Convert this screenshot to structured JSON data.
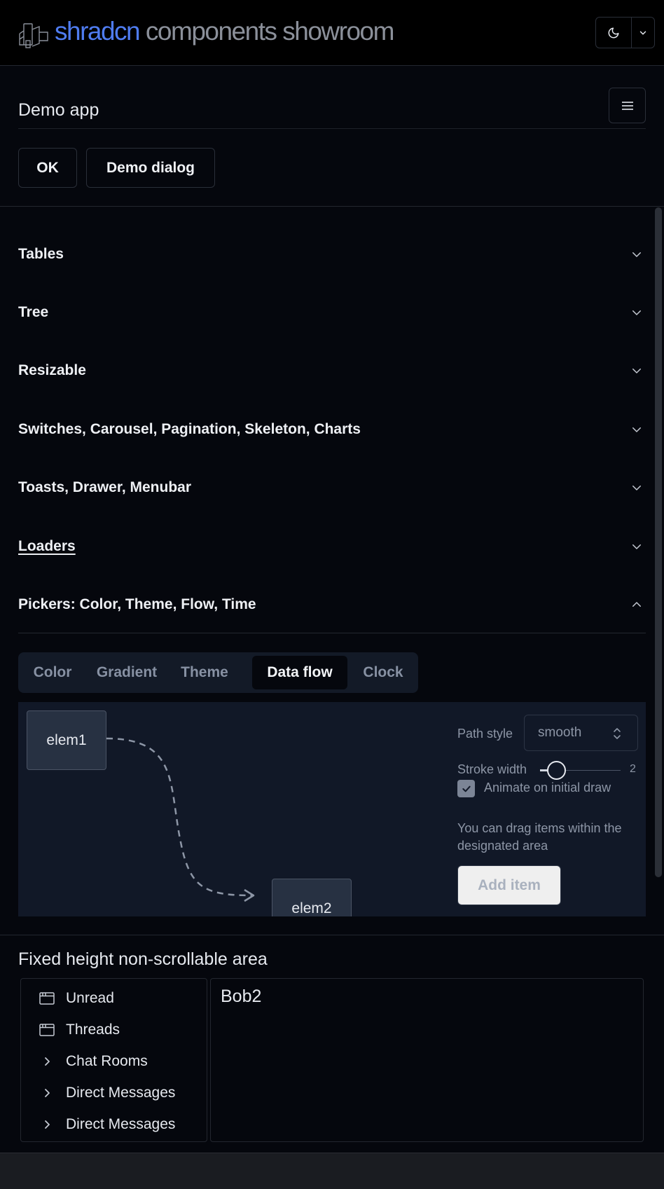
{
  "header": {
    "brand_part1": "shradcn",
    "brand_part2": " components showroom",
    "theme_icon": "moon-icon",
    "theme_menu_icon": "chevron-down-icon"
  },
  "app": {
    "title": "Demo app",
    "menu_icon": "hamburger-icon",
    "ok_label": "OK",
    "dialog_label": "Demo dialog"
  },
  "accordion": {
    "items": [
      {
        "label": "Tables",
        "expanded": false
      },
      {
        "label": "Tree",
        "expanded": false
      },
      {
        "label": "Resizable",
        "expanded": false
      },
      {
        "label": "Switches, Carousel, Pagination, Skeleton, Charts",
        "expanded": false
      },
      {
        "label": "Toasts, Drawer, Menubar",
        "expanded": false
      },
      {
        "label": "Loaders",
        "expanded": false
      },
      {
        "label": "Pickers: Color, Theme, Flow, Time",
        "expanded": true
      }
    ]
  },
  "pickers": {
    "tabs": [
      {
        "label": "Color",
        "active": false
      },
      {
        "label": "Gradient",
        "active": false
      },
      {
        "label": "Theme",
        "active": false
      },
      {
        "label": "Data flow",
        "active": true
      },
      {
        "label": "Clock",
        "active": false
      }
    ],
    "flow": {
      "nodes": [
        "elem1",
        "elem2"
      ],
      "path_style_label": "Path style",
      "path_style_value": "smooth",
      "stroke_width_label": "Stroke width",
      "stroke_width_value": "2",
      "animate_label": "Animate on initial draw",
      "animate_checked": true,
      "hint": "You can drag items within the designated area",
      "add_item_label": "Add item"
    }
  },
  "fixed": {
    "title": "Fixed height non-scrollable area",
    "nav": [
      {
        "label": "Unread",
        "icon": "inbox-icon"
      },
      {
        "label": "Threads",
        "icon": "inbox-icon"
      },
      {
        "label": "Chat Rooms",
        "icon": "chevron-right-icon"
      },
      {
        "label": "Direct Messages",
        "icon": "chevron-right-icon"
      },
      {
        "label": "Direct Messages",
        "icon": "chevron-right-icon"
      }
    ],
    "content": "Bob2"
  },
  "colors": {
    "brand_blue": "#4f7cf0",
    "background": "#05070d",
    "panel": "#111827"
  }
}
